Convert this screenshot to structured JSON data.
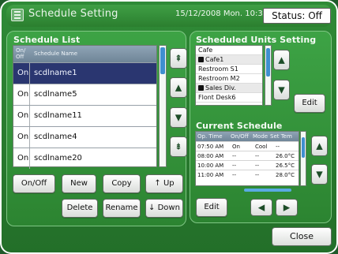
{
  "title": "Schedule Setting",
  "datetime": "15/12/2008 Mon. 10:39 AM",
  "status": "Status: Off",
  "schedule_list": {
    "title": "Schedule List",
    "col_onoff": "On/ Off",
    "col_name": "Schedule Name",
    "rows": [
      {
        "onoff": "On",
        "name": "scdlname1"
      },
      {
        "onoff": "On",
        "name": "scdlname5"
      },
      {
        "onoff": "On",
        "name": "scdlname11"
      },
      {
        "onoff": "On",
        "name": "scdlname4"
      },
      {
        "onoff": "On",
        "name": "scdlname20"
      }
    ]
  },
  "buttons": {
    "onoff": "On/Off",
    "new": "New",
    "copy": "Copy",
    "up": "Up",
    "delete": "Delete",
    "rename": "Rename",
    "down": "Down",
    "edit_units": "Edit",
    "edit_current": "Edit",
    "close": "Close"
  },
  "units_setting": {
    "title": "Scheduled Units Setting",
    "items": [
      {
        "name": "Cafe",
        "icon": false
      },
      {
        "name": "Cafe1",
        "icon": true
      },
      {
        "name": "Restroom S1",
        "icon": false
      },
      {
        "name": "Restroom M2",
        "icon": false
      },
      {
        "name": "Sales Div.",
        "icon": true
      },
      {
        "name": "Flont Desk6",
        "icon": false
      }
    ]
  },
  "current_schedule": {
    "title": "Current Schedule",
    "headers": [
      "Op. Time",
      "On/Off",
      "Mode",
      "Set Tem"
    ],
    "rows": [
      [
        "07:50 AM",
        "On",
        "Cool",
        "--"
      ],
      [
        "08:00 AM",
        "--",
        "--",
        "26.0°C"
      ],
      [
        "10:00 AM",
        "--",
        "--",
        "26.5°C"
      ],
      [
        "11:00 AM",
        "--",
        "--",
        "28.0°C"
      ]
    ]
  }
}
